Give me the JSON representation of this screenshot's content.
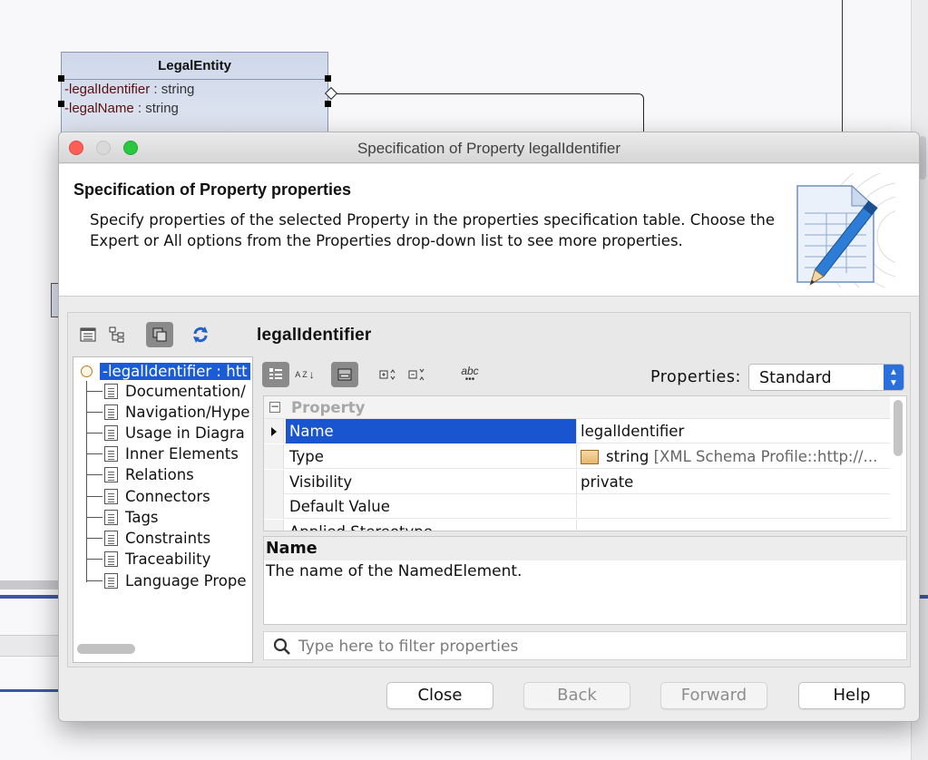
{
  "diagram": {
    "class_name": "LegalEntity",
    "attributes": [
      {
        "name": "-legalIdentifier",
        "type": " : string"
      },
      {
        "name": "-legalName",
        "type": " : string"
      }
    ]
  },
  "window": {
    "title": "Specification of Property legalIdentifier"
  },
  "header": {
    "title": "Specification of Property properties",
    "description": "Specify properties of the selected Property in the properties specification table. Choose the Expert or All options from the Properties drop-down list to see more properties."
  },
  "toolbar": {
    "element_title": "legalIdentifier"
  },
  "tree": {
    "root": "-legalIdentifier : htt",
    "items": [
      "Documentation/",
      "Navigation/Hype",
      "Usage in Diagra",
      "Inner Elements",
      "Relations",
      "Connectors",
      "Tags",
      "Constraints",
      "Traceability",
      "Language Prope"
    ]
  },
  "properties": {
    "label": "Properties:",
    "selected": "Standard",
    "group": "Property",
    "sort_az_label": "A Z",
    "abc_label": "abc",
    "rows": [
      {
        "name": "Name",
        "value": "legalIdentifier"
      },
      {
        "name": "Type",
        "value": "string",
        "value_extra": "[XML Schema Profile::http://..."
      },
      {
        "name": "Visibility",
        "value": "private"
      },
      {
        "name": "Default Value",
        "value": ""
      },
      {
        "name": "Applied Stereotype",
        "value": ""
      }
    ]
  },
  "description": {
    "title": "Name",
    "text": "The name of the NamedElement."
  },
  "filter": {
    "placeholder": "Type here to filter properties"
  },
  "buttons": {
    "close": "Close",
    "back": "Back",
    "forward": "Forward",
    "help": "Help"
  }
}
